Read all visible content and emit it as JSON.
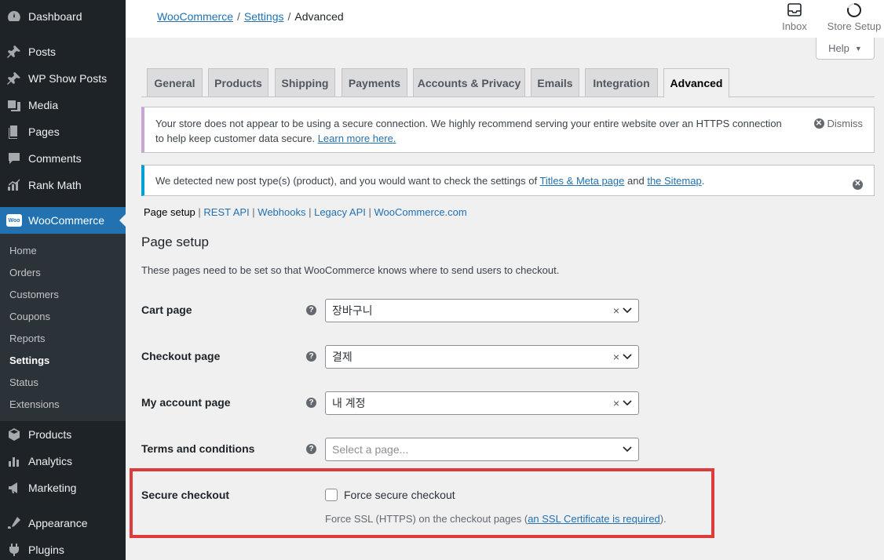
{
  "sidebar": {
    "menu": [
      {
        "label": "Dashboard",
        "icon": "dashboard-icon"
      },
      {
        "label": "Posts",
        "icon": "pin-icon"
      },
      {
        "label": "WP Show Posts",
        "icon": "pin-icon"
      },
      {
        "label": "Media",
        "icon": "media-icon"
      },
      {
        "label": "Pages",
        "icon": "pages-icon"
      },
      {
        "label": "Comments",
        "icon": "comments-icon"
      },
      {
        "label": "Rank Math",
        "icon": "rank-math-icon"
      },
      {
        "label": "WooCommerce",
        "icon": "woo-icon"
      },
      {
        "label": "Products",
        "icon": "products-icon"
      },
      {
        "label": "Analytics",
        "icon": "analytics-icon"
      },
      {
        "label": "Marketing",
        "icon": "marketing-icon"
      },
      {
        "label": "Appearance",
        "icon": "appearance-icon"
      },
      {
        "label": "Plugins",
        "icon": "plugins-icon"
      }
    ],
    "woo_badge": "Woo",
    "submenu": [
      "Home",
      "Orders",
      "Customers",
      "Coupons",
      "Reports",
      "Settings",
      "Status",
      "Extensions"
    ]
  },
  "topbar": {
    "breadcrumb": {
      "root": "WooCommerce",
      "parent": "Settings",
      "current": "Advanced",
      "separator": "/"
    },
    "inbox_label": "Inbox",
    "store_setup_label": "Store Setup"
  },
  "help_label": "Help",
  "tabs": [
    "General",
    "Products",
    "Shipping",
    "Payments",
    "Accounts & Privacy",
    "Emails",
    "Integration",
    "Advanced"
  ],
  "notice_ssl": {
    "text": "Your store does not appear to be using a secure connection. We highly recommend serving your entire website over an HTTPS connection to help keep customer data secure.",
    "link": "Learn more here.",
    "dismiss": "Dismiss"
  },
  "notice_posttype": {
    "text_before": "We detected new post type(s) (product), and you would want to check the settings of",
    "link1": "Titles & Meta page",
    "and": "and",
    "link2": "the Sitemap",
    "end": "."
  },
  "subsections": [
    "Page setup",
    "REST API",
    "Webhooks",
    "Legacy API",
    "WooCommerce.com"
  ],
  "section": {
    "title": "Page setup",
    "description": "These pages need to be set so that WooCommerce knows where to send users to checkout."
  },
  "fields": [
    {
      "label": "Cart page",
      "value": "장바구니",
      "clearable": true
    },
    {
      "label": "Checkout page",
      "value": "결제",
      "clearable": true
    },
    {
      "label": "My account page",
      "value": "내 계정",
      "clearable": true
    },
    {
      "label": "Terms and conditions",
      "value": "Select a page...",
      "clearable": false
    }
  ],
  "secure_checkout": {
    "label": "Secure checkout",
    "checkbox_label": "Force secure checkout",
    "checked": false,
    "desc_before": "Force SSL (HTTPS) on the checkout pages (",
    "desc_link": "an SSL Certificate is required",
    "desc_after": ")."
  },
  "colors": {
    "sidebar_bg": "#1d2327",
    "accent": "#2271b1",
    "highlight": "#e03b3b"
  }
}
